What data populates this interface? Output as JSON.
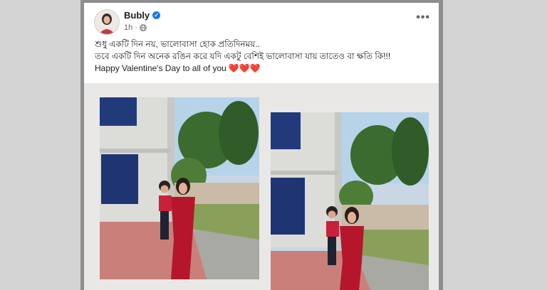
{
  "post": {
    "author": "Bubly",
    "verified": true,
    "time": "1h",
    "privacy_icon": "globe-icon",
    "more_icon": "more-options-icon",
    "caption": {
      "line1": "শুধু একটি দিন নয়, ভালোবাসা হোক প্রতিদিনময়..",
      "line2": "তবে একটি দিন অনেক রঙিন করে যদি একটু বেশিই ভালোবাসা যায় তাতেও বা ক্ষতি কি!!!",
      "line3": "Happy Valentine's Day to all of you",
      "hearts": "❤️❤️❤️"
    },
    "photos": [
      {
        "name": "photo-left",
        "description_icon": "mother-child-photo"
      },
      {
        "name": "photo-right",
        "description_icon": "mother-child-photo"
      }
    ]
  }
}
